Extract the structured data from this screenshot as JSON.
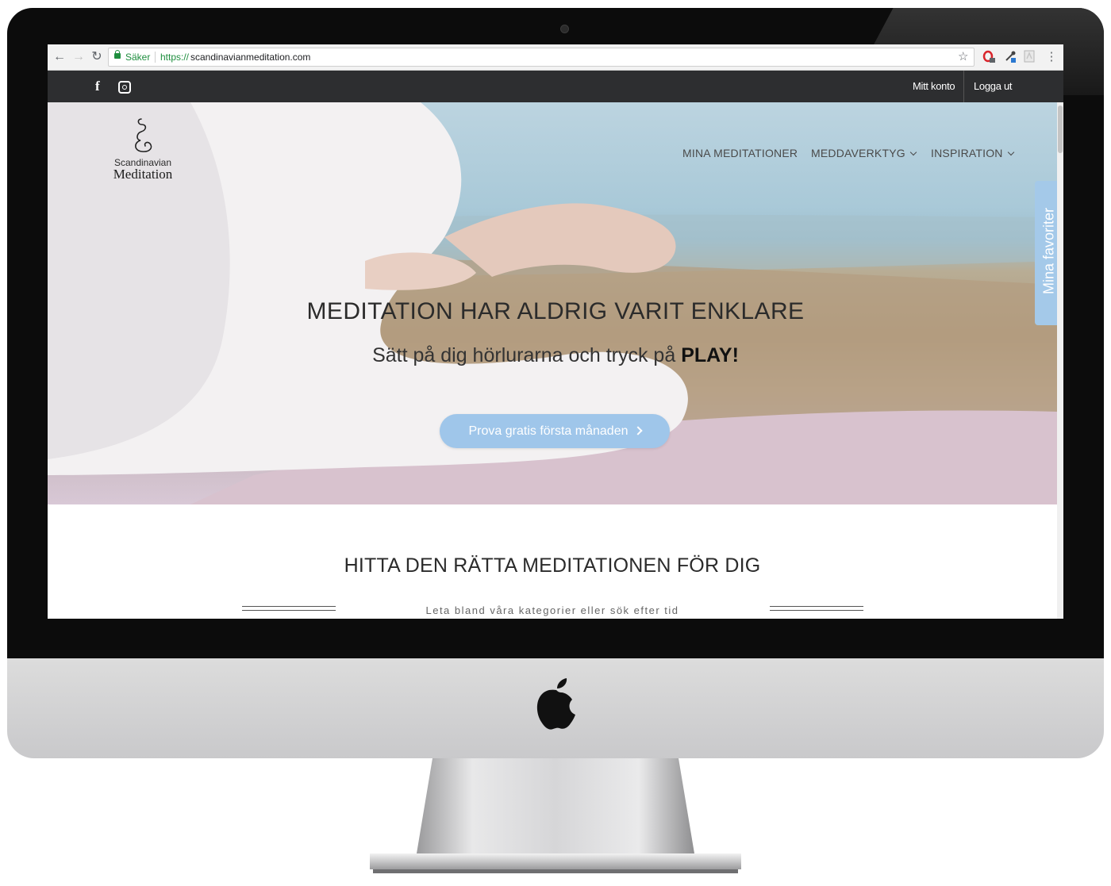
{
  "browser": {
    "secure_label": "Säker",
    "url_scheme": "https://",
    "url_host": "scandinavianmeditation.com",
    "back_icon": "arrow-left-icon",
    "forward_icon": "arrow-right-icon",
    "reload_icon": "reload-icon",
    "bookmark_icon": "star-icon",
    "menu_icon": "kebab-menu-icon"
  },
  "topbar": {
    "social": [
      "facebook-icon",
      "instagram-icon"
    ],
    "account_label": "Mitt konto",
    "logout_label": "Logga ut"
  },
  "logo": {
    "line1": "Scandinavian",
    "line2": "Meditation"
  },
  "nav": {
    "items": [
      {
        "label": "MINA MEDITATIONER",
        "has_dropdown": false
      },
      {
        "label": "MEDDAVERKTYG",
        "has_dropdown": true
      },
      {
        "label": "INSPIRATION",
        "has_dropdown": true
      }
    ]
  },
  "hero": {
    "title": "MEDITATION HAR ALDRIG VARIT ENKLARE",
    "subtitle_prefix": "Sätt på dig hörlurarna och tryck på",
    "subtitle_emphasis": "PLAY!",
    "cta_label": "Prova gratis första månaden"
  },
  "favorites_tab": {
    "label": "Mina favoriter"
  },
  "section": {
    "title": "HITTA DEN RÄTTA MEDITATIONEN FÖR DIG",
    "subtitle": "Leta bland våra kategorier eller sök efter tid"
  },
  "colors": {
    "topbar_bg": "#2d2e30",
    "cta_bg": "#9fc6ea",
    "fav_tab_bg": "#a4c9e9",
    "secure_green": "#1e8e3e"
  }
}
